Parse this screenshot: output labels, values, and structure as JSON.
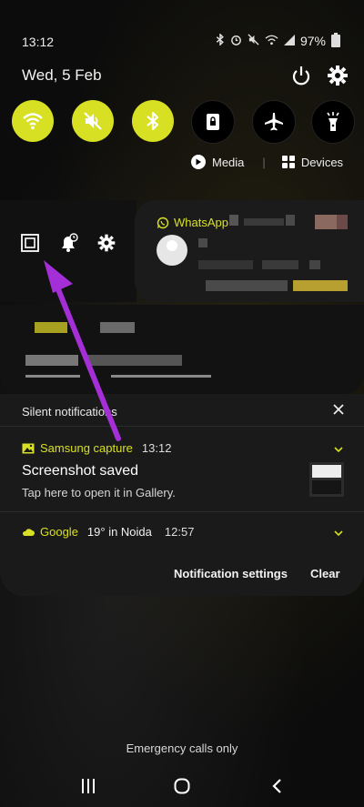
{
  "status": {
    "time": "13:12",
    "battery": "97%"
  },
  "header": {
    "date": "Wed, 5 Feb"
  },
  "quick_settings": {
    "toggles": [
      {
        "icon": "wifi-icon",
        "active": true
      },
      {
        "icon": "mute-icon",
        "active": true
      },
      {
        "icon": "bluetooth-icon",
        "active": true
      },
      {
        "icon": "screen-lock-icon",
        "active": false
      },
      {
        "icon": "airplane-icon",
        "active": false
      },
      {
        "icon": "flashlight-icon",
        "active": false
      }
    ],
    "media_label": "Media",
    "devices_label": "Devices",
    "accent_color": "#d8e023"
  },
  "whatsapp": {
    "app_name": "WhatsApp"
  },
  "silent": {
    "title": "Silent notifications",
    "samsung": {
      "app": "Samsung capture",
      "time": "13:12",
      "title": "Screenshot saved",
      "subtitle": "Tap here to open it in Gallery."
    },
    "google": {
      "app": "Google",
      "weather": "19° in Noida",
      "time": "12:57"
    },
    "settings_label": "Notification settings",
    "clear_label": "Clear"
  },
  "footer": {
    "emergency": "Emergency calls only"
  },
  "annotation": {
    "arrow_color": "#a52fd6"
  }
}
